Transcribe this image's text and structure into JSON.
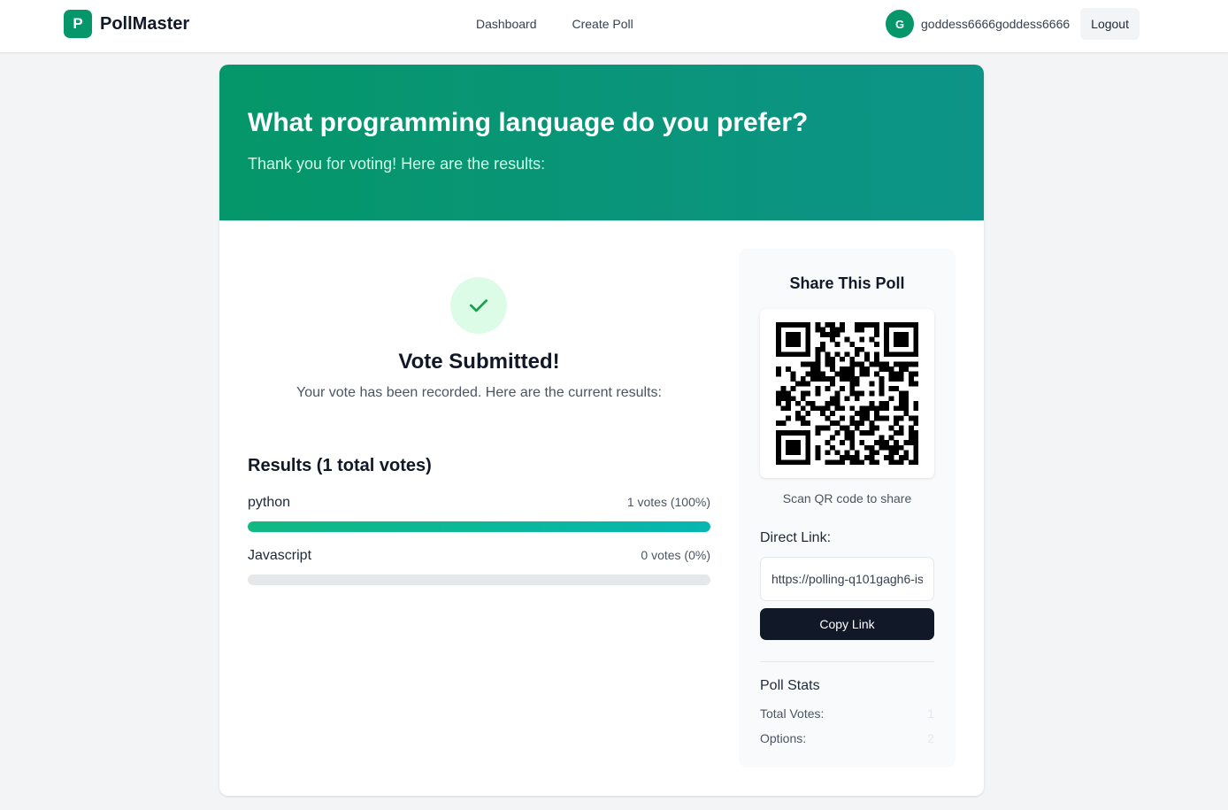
{
  "nav": {
    "brand_letter": "P",
    "brand_name": "PollMaster",
    "links": [
      "Dashboard",
      "Create Poll"
    ],
    "user_initial": "G",
    "username": "goddess6666goddess6666",
    "logout_label": "Logout"
  },
  "poll": {
    "question": "What programming language do you prefer?",
    "subtitle": "Thank you for voting! Here are the results:"
  },
  "confirmation": {
    "title": "Vote Submitted!",
    "text": "Your vote has been recorded. Here are the current results:"
  },
  "results": {
    "title": "Results (1 total votes)",
    "options": [
      {
        "name": "python",
        "votes_label": "1 votes (100%)",
        "percent": 100
      },
      {
        "name": "Javascript",
        "votes_label": "0 votes (0%)",
        "percent": 0
      }
    ]
  },
  "share": {
    "title": "Share This Poll",
    "qr_caption": "Scan QR code to share",
    "direct_link_label": "Direct Link:",
    "link_value": "https://polling-q101gagh6-is",
    "copy_label": "Copy Link",
    "stats_title": "Poll Stats",
    "stats": [
      {
        "label": "Total Votes:",
        "value": "1"
      },
      {
        "label": "Options:",
        "value": "2"
      }
    ]
  },
  "colors": {
    "brand": "#059669",
    "hero_start": "#059669",
    "hero_end": "#0d9488",
    "bar_fill": "#10b981",
    "button_dark": "#111827"
  }
}
